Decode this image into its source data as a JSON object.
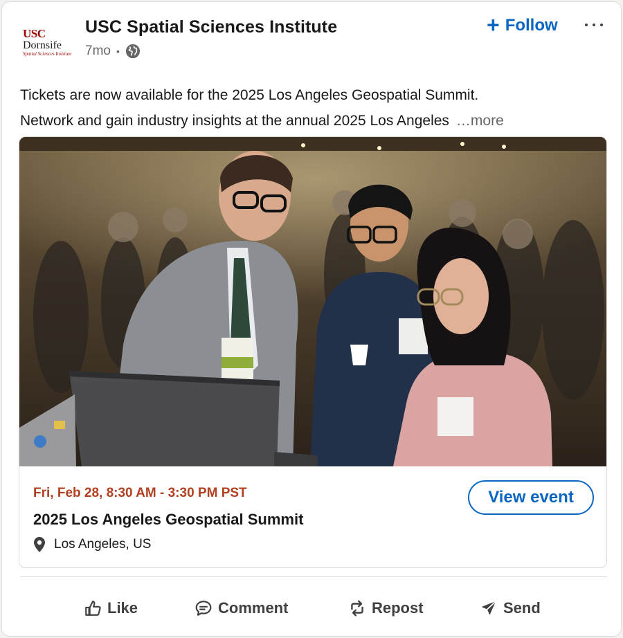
{
  "post": {
    "author": {
      "name": "USC Spatial Sciences Institute",
      "logo_line1": "USC",
      "logo_line2": "Dornsife",
      "logo_line3": "Spatial Sciences Institute",
      "age": "7mo",
      "separator": "•",
      "visibility_icon": "globe-icon"
    },
    "follow_label": "Follow",
    "follow_icon": "plus-icon",
    "overflow_icon": "more-options-icon",
    "text_line1": "Tickets are now available for the 2025 Los Angeles Geospatial Summit.",
    "text_line2": "Network and gain industry insights at the annual 2025 Los Angeles",
    "see_more": "…more"
  },
  "event": {
    "date": "Fri, Feb 28, 8:30 AM - 3:30 PM PST",
    "title": "2025 Los Angeles Geospatial Summit",
    "location": "Los Angeles, US",
    "location_icon": "map-pin-icon",
    "view_label": "View event"
  },
  "actions": [
    {
      "label": "Like",
      "icon": "thumbs-up-icon"
    },
    {
      "label": "Comment",
      "icon": "comment-icon"
    },
    {
      "label": "Repost",
      "icon": "repost-icon"
    },
    {
      "label": "Send",
      "icon": "send-icon"
    }
  ],
  "colors": {
    "brand_blue": "#0a66c2",
    "event_date": "#b24020",
    "usc_cardinal": "#990000"
  }
}
